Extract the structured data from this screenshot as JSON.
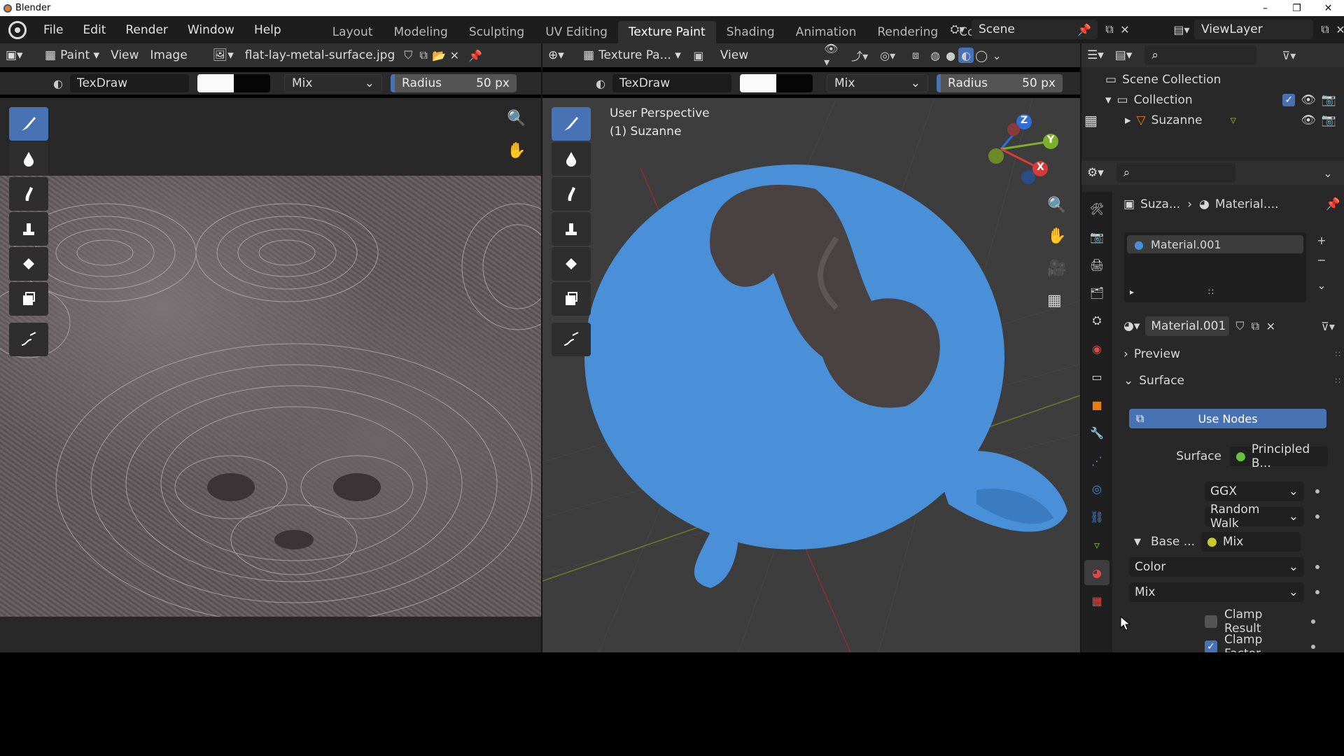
{
  "window": {
    "title": "Blender",
    "minimize": "–",
    "maximize": "❐",
    "close": "✕"
  },
  "menu": [
    "File",
    "Edit",
    "Render",
    "Window",
    "Help"
  ],
  "workspaces": [
    "Layout",
    "Modeling",
    "Sculpting",
    "UV Editing",
    "Texture Paint",
    "Shading",
    "Animation",
    "Rendering",
    "Compositin"
  ],
  "active_workspace": "Texture Paint",
  "scene": "Scene",
  "view_layer": "ViewLayer",
  "image_editor": {
    "mode": "Paint",
    "view": "View",
    "image": "Image",
    "image_name": "flat-lay-metal-surface.jpg",
    "brush": "TexDraw",
    "blend": "Mix",
    "radius_label": "Radius",
    "radius_value": "50 px"
  },
  "viewport": {
    "mode": "Texture Pa...",
    "view": "View",
    "brush": "TexDraw",
    "blend": "Mix",
    "radius_label": "Radius",
    "radius_value": "50 px",
    "perspective": "User Perspective",
    "object": "(1) Suzanne",
    "gizmo_labels": {
      "z": "Z",
      "y": "Y",
      "x": "X"
    }
  },
  "outliner": {
    "scene_collection": "Scene Collection",
    "collection": "Collection",
    "object": "Suzanne"
  },
  "properties": {
    "breadcrumb_obj": "Suza...",
    "breadcrumb_mat": "Material....",
    "slot": "Material.001",
    "material_name": "Material.001",
    "preview": "Preview",
    "surface_panel": "Surface",
    "use_nodes": "Use Nodes",
    "surface_label": "Surface",
    "surface_value": "Principled B...",
    "distribution": "GGX",
    "subsurface": "Random Walk",
    "base_label": "Base ...",
    "base_value": "Mix",
    "color_mode": "Color",
    "blend_mode": "Mix",
    "clamp_result": "Clamp Result",
    "clamp_factor": "Clamp Factor",
    "clamp_result_checked": false,
    "clamp_factor_checked": true
  },
  "colors": {
    "accent": "#4772b3",
    "suzanne": "#4a90d9",
    "header": "#303030",
    "panel": "#282828"
  }
}
